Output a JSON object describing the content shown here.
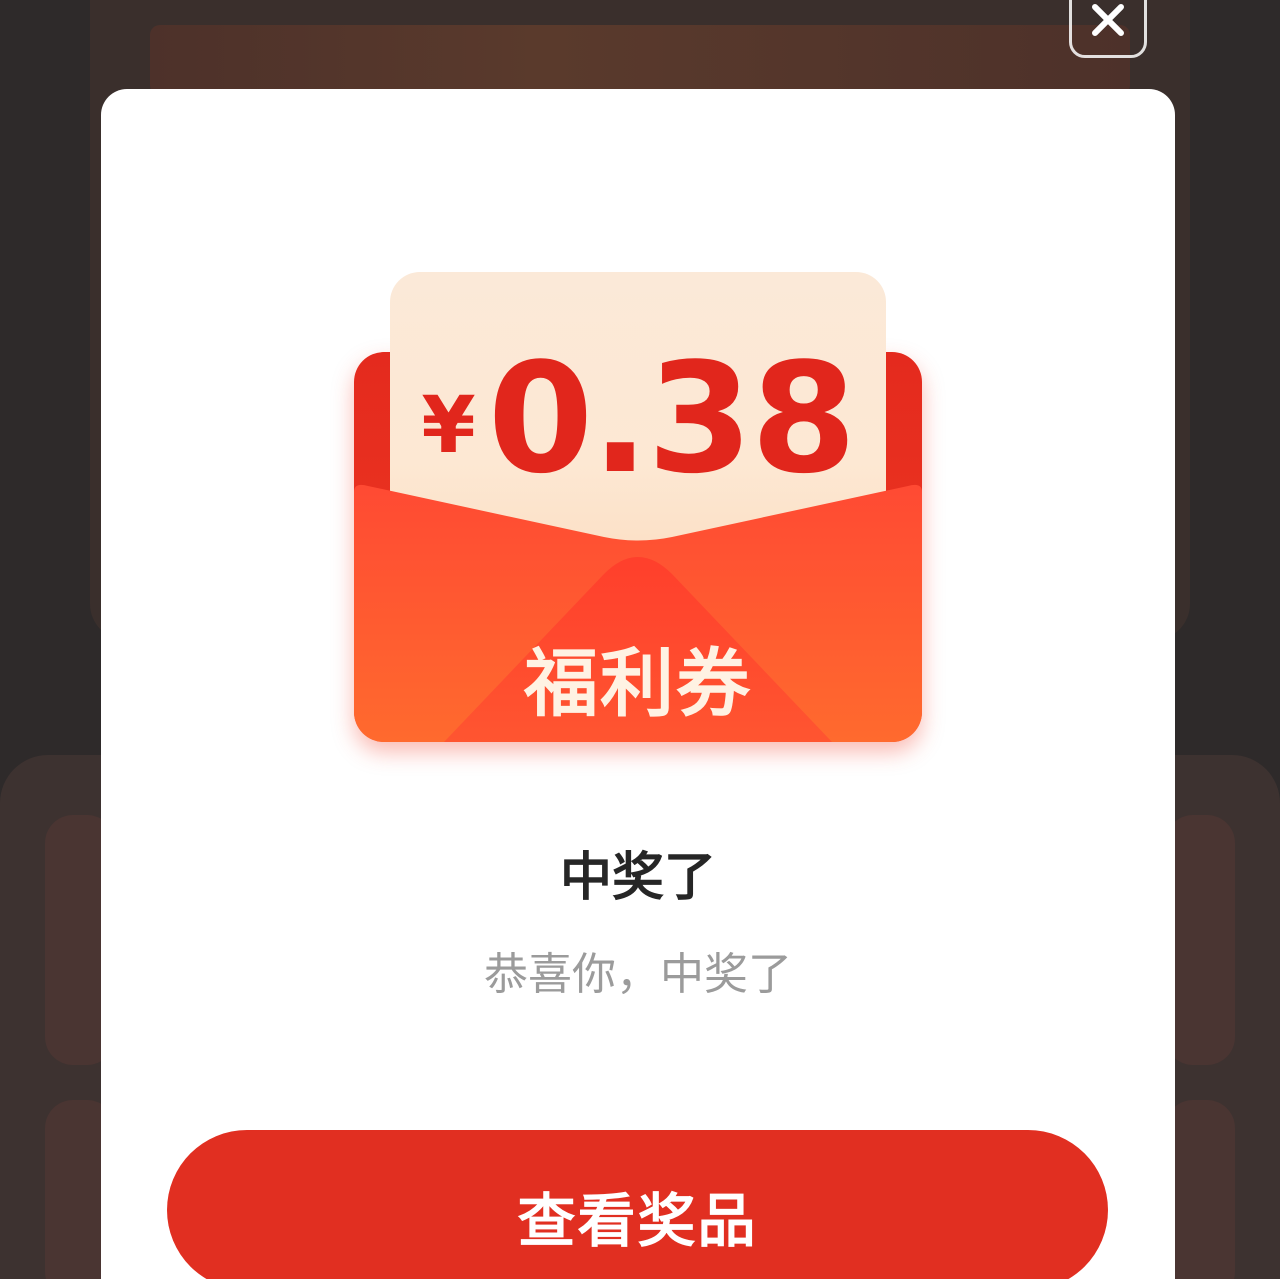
{
  "colors": {
    "accent": "#e12f21",
    "amount_red": "#e1261c",
    "backdrop": "#2e2a2a"
  },
  "dialog": {
    "close_icon": "close-icon",
    "coupon": {
      "currency_symbol": "¥",
      "amount": "0.38",
      "label": "福利券"
    },
    "title": "中奖了",
    "message": "恭喜你，中奖了",
    "primary_button_label": "查看奖品"
  }
}
